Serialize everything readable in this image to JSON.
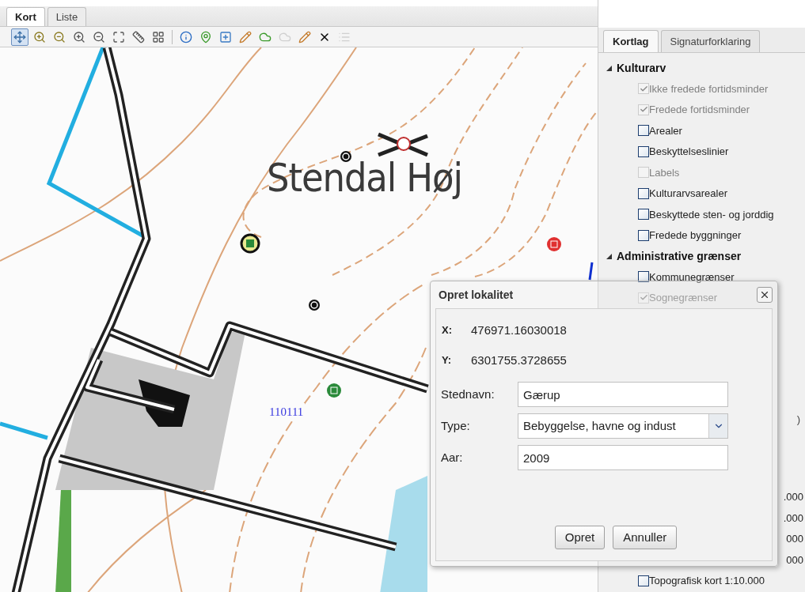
{
  "main_tabs": [
    {
      "label": "Kort",
      "selected": true
    },
    {
      "label": "Liste",
      "selected": false
    }
  ],
  "toolbar": [
    {
      "kind": "pan",
      "selected": true,
      "disabled": false
    },
    {
      "kind": "zoom-box-in",
      "selected": false,
      "disabled": false
    },
    {
      "kind": "zoom-box-out",
      "selected": false,
      "disabled": false
    },
    {
      "kind": "zoom-in",
      "selected": false,
      "disabled": false
    },
    {
      "kind": "zoom-out",
      "selected": false,
      "disabled": false
    },
    {
      "kind": "extent",
      "selected": false,
      "disabled": false
    },
    {
      "kind": "measure-line",
      "selected": false,
      "disabled": false
    },
    {
      "kind": "measure-area",
      "selected": false,
      "disabled": false
    },
    {
      "kind": "separator",
      "selected": false,
      "disabled": false
    },
    {
      "kind": "info",
      "selected": false,
      "disabled": false
    },
    {
      "kind": "add-point",
      "selected": false,
      "disabled": false
    },
    {
      "kind": "add-point-box",
      "selected": false,
      "disabled": false
    },
    {
      "kind": "edit-point",
      "selected": false,
      "disabled": false
    },
    {
      "kind": "add-area",
      "selected": false,
      "disabled": false
    },
    {
      "kind": "add-area",
      "selected": false,
      "disabled": true
    },
    {
      "kind": "edit-area",
      "selected": false,
      "disabled": false
    },
    {
      "kind": "delete",
      "selected": false,
      "disabled": false
    },
    {
      "kind": "list",
      "selected": false,
      "disabled": true
    }
  ],
  "map": {
    "place_label": "Stendal Høj",
    "feature_label": "110111"
  },
  "side_tabs": [
    {
      "label": "Kortlag",
      "selected": true
    },
    {
      "label": "Signaturforklaring",
      "selected": false
    }
  ],
  "layer_groups": [
    {
      "label": "Kulturarv",
      "expanded": true,
      "children": [
        {
          "label": "Ikke fredede fortidsminder",
          "checked": true,
          "disabled": true
        },
        {
          "label": "Fredede fortidsminder",
          "checked": true,
          "disabled": true
        },
        {
          "label": "Arealer",
          "checked": false,
          "disabled": false
        },
        {
          "label": "Beskyttelseslinier",
          "checked": false,
          "disabled": false
        },
        {
          "label": "Labels",
          "checked": false,
          "disabled": true
        },
        {
          "label": "Kulturarvsarealer",
          "checked": false,
          "disabled": false
        },
        {
          "label": "Beskyttede sten- og jorddig",
          "checked": false,
          "disabled": false
        },
        {
          "label": "Fredede byggninger",
          "checked": false,
          "disabled": false
        }
      ]
    },
    {
      "label": "Administrative grænser",
      "expanded": true,
      "children": [
        {
          "label": "Kommunegrænser",
          "checked": false,
          "disabled": false
        },
        {
          "label": "Sognegrænser",
          "checked": true,
          "disabled": true
        }
      ]
    }
  ],
  "partial_rows": [
    ")",
    ".000",
    ".000",
    "000",
    "000"
  ],
  "last_layer": {
    "label": "Topografisk kort 1:10.000",
    "checked": false,
    "disabled": false
  },
  "dialog": {
    "title": "Opret lokalitet",
    "x_label": "X:",
    "x_value": "476971.16030018",
    "y_label": "Y:",
    "y_value": "6301755.3728655",
    "fields": [
      {
        "kind": "text",
        "label": "Stednavn:",
        "value": "Gærup"
      },
      {
        "kind": "select",
        "label": "Type:",
        "value": "Bebyggelse, havne og indust"
      },
      {
        "kind": "text",
        "label": "Aar:",
        "value": "2009"
      }
    ],
    "buttons": [
      "Opret",
      "Annuller"
    ]
  }
}
